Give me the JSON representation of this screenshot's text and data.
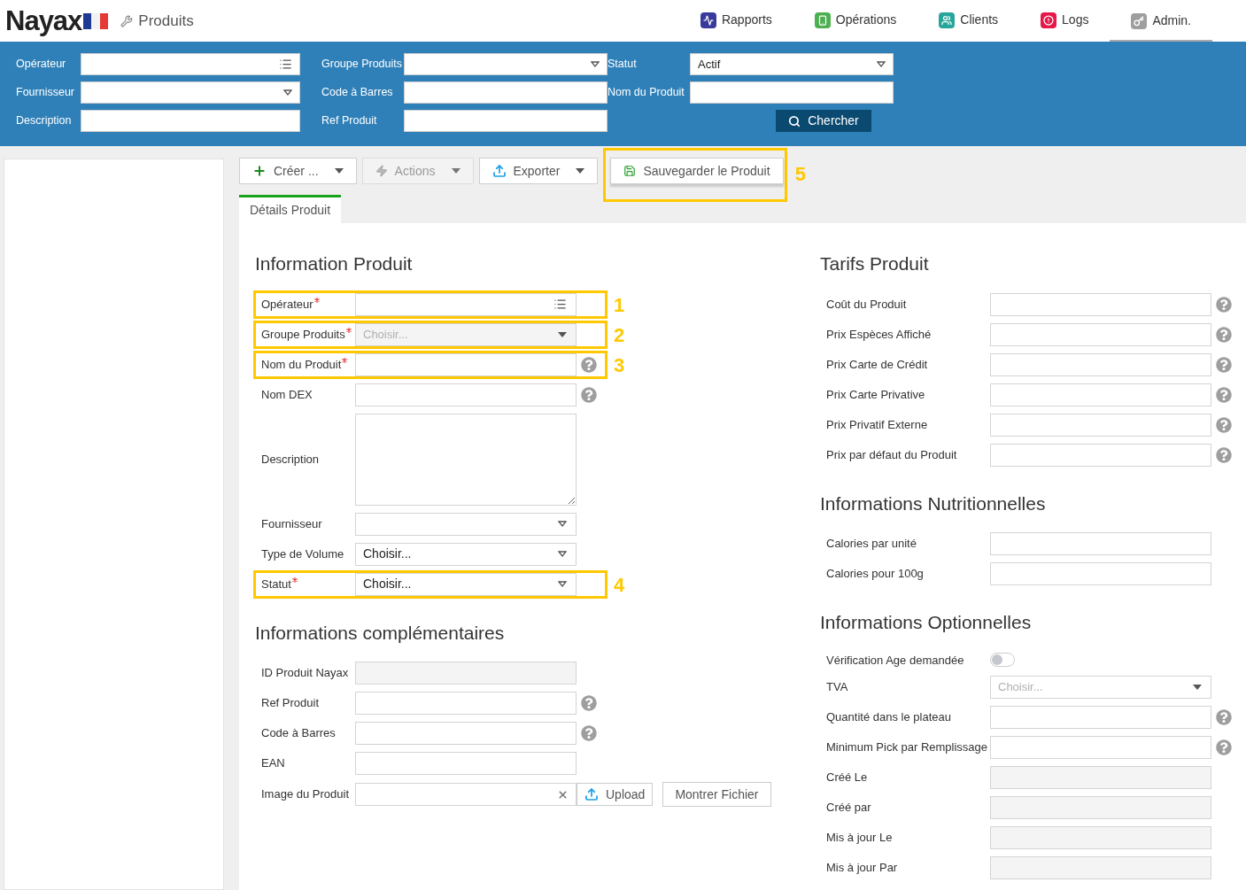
{
  "header": {
    "logo": "Nayax",
    "page_title": "Produits",
    "nav": [
      {
        "label": "Rapports",
        "color": "#3a3a9c",
        "kind": "reports",
        "selected": false
      },
      {
        "label": "Opérations",
        "color": "#4caf50",
        "kind": "operations",
        "selected": false
      },
      {
        "label": "Clients",
        "color": "#26a69a",
        "kind": "clients",
        "selected": false
      },
      {
        "label": "Logs",
        "color": "#e5194a",
        "kind": "logs",
        "selected": false
      },
      {
        "label": "Admin.",
        "color": "#9e9e9e",
        "kind": "admin",
        "selected": true
      }
    ]
  },
  "filters": {
    "columns": [
      [
        {
          "label": "Opérateur",
          "kind": "list-input"
        },
        {
          "label": "Fournisseur",
          "kind": "select"
        },
        {
          "label": "Description",
          "kind": "input"
        }
      ],
      [
        {
          "label": "Groupe Produits",
          "kind": "select"
        },
        {
          "label": "Code à Barres",
          "kind": "input"
        },
        {
          "label": "Ref Produit",
          "kind": "input"
        }
      ],
      [
        {
          "label": "Statut",
          "kind": "select",
          "value": "Actif"
        },
        {
          "label": "Nom du Produit",
          "kind": "input"
        }
      ]
    ],
    "search_button": "Chercher"
  },
  "toolbar": [
    {
      "label": "Créer ...",
      "kind": "create",
      "disabled": false
    },
    {
      "label": "Actions",
      "kind": "actions",
      "disabled": true
    },
    {
      "label": "Exporter",
      "kind": "export",
      "disabled": false
    },
    {
      "label": "Sauvegarder le Produit",
      "kind": "save",
      "disabled": false,
      "callout": "5"
    }
  ],
  "tabs": [
    {
      "label": "Détails Produit",
      "selected": true
    }
  ],
  "form": {
    "left": [
      {
        "title": "Information Produit",
        "fields": [
          {
            "label": "Opérateur",
            "kind": "list-input",
            "required": true,
            "help": false,
            "callout": "1"
          },
          {
            "label": "Groupe Produits",
            "kind": "locked-select",
            "required": true,
            "help": false,
            "placeholder": "Choisir...",
            "callout": "2"
          },
          {
            "label": "Nom du Produit",
            "kind": "input",
            "required": true,
            "help": true,
            "callout": "3"
          },
          {
            "label": "Nom DEX",
            "kind": "input",
            "required": false,
            "help": true
          },
          {
            "label": "Description",
            "kind": "textarea",
            "required": false,
            "help": false
          },
          {
            "label": "Fournisseur",
            "kind": "select",
            "required": false,
            "help": false
          },
          {
            "label": "Type de Volume",
            "kind": "select",
            "required": false,
            "help": false,
            "value": "Choisir..."
          },
          {
            "label": "Statut",
            "kind": "select",
            "required": true,
            "help": false,
            "value": "Choisir...",
            "callout": "4"
          }
        ]
      },
      {
        "title": "Informations complémentaires",
        "fields": [
          {
            "label": "ID Produit Nayax",
            "kind": "readonly-input",
            "required": false,
            "help": false
          },
          {
            "label": "Ref Produit",
            "kind": "input",
            "required": false,
            "help": true
          },
          {
            "label": "Code à Barres",
            "kind": "input",
            "required": false,
            "help": true
          },
          {
            "label": "EAN",
            "kind": "input",
            "required": false,
            "help": false
          },
          {
            "label": "Image du Produit",
            "kind": "file",
            "required": false,
            "help": false,
            "buttons": [
              "Upload",
              "Montrer Fichier"
            ]
          }
        ]
      }
    ],
    "right": [
      {
        "title": "Tarifs Produit",
        "fields": [
          {
            "label": "Coût du Produit",
            "kind": "input",
            "required": false,
            "help": true
          },
          {
            "label": "Prix Espèces Affiché",
            "kind": "input",
            "required": false,
            "help": true
          },
          {
            "label": "Prix Carte de Crédit",
            "kind": "input",
            "required": false,
            "help": true
          },
          {
            "label": "Prix Carte Privative",
            "kind": "input",
            "required": false,
            "help": true
          },
          {
            "label": "Prix Privatif Externe",
            "kind": "input",
            "required": false,
            "help": true
          },
          {
            "label": "Prix par défaut du Produit",
            "kind": "input",
            "required": false,
            "help": true
          }
        ]
      },
      {
        "title": "Informations Nutritionnelles",
        "fields": [
          {
            "label": "Calories par unité",
            "kind": "input",
            "required": false,
            "help": false
          },
          {
            "label": "Calories pour 100g",
            "kind": "input",
            "required": false,
            "help": false
          }
        ]
      },
      {
        "title": "Informations Optionnelles",
        "fields": [
          {
            "label": "Vérification Age demandée",
            "kind": "toggle",
            "required": false,
            "help": false,
            "on": false
          },
          {
            "label": "TVA",
            "kind": "select",
            "required": false,
            "help": false,
            "placeholder": "Choisir..."
          },
          {
            "label": "Quantité dans le plateau",
            "kind": "input",
            "required": false,
            "help": true
          },
          {
            "label": "Minimum Pick par Remplissage",
            "kind": "input",
            "required": false,
            "help": true
          },
          {
            "label": "Créé Le",
            "kind": "readonly-input",
            "required": false,
            "help": false
          },
          {
            "label": "Créé par",
            "kind": "readonly-input",
            "required": false,
            "help": false
          },
          {
            "label": "Mis à jour Le",
            "kind": "readonly-input",
            "required": false,
            "help": false
          },
          {
            "label": "Mis à jour Par",
            "kind": "readonly-input",
            "required": false,
            "help": false
          }
        ]
      }
    ]
  }
}
